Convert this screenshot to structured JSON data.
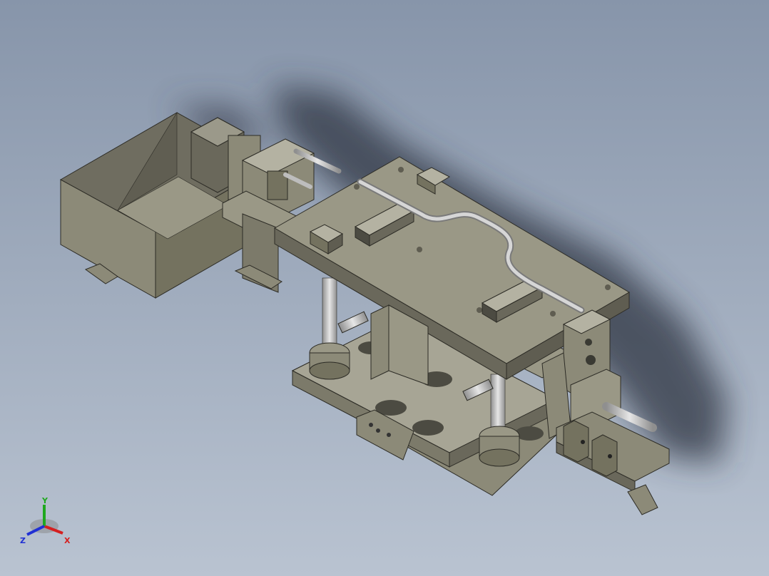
{
  "viewport": {
    "background_top": "#8795aa",
    "background_bottom": "#b9c3d1"
  },
  "model": {
    "part_color": "#8c8a78",
    "part_dark": "#5f5d51",
    "part_light": "#b4b2a2",
    "shaft_color": "#c9c9c9"
  },
  "triad": {
    "x_label": "X",
    "y_label": "Y",
    "z_label": "Z",
    "x_color": "#d42020",
    "y_color": "#1fa81f",
    "z_color": "#2030d4"
  }
}
